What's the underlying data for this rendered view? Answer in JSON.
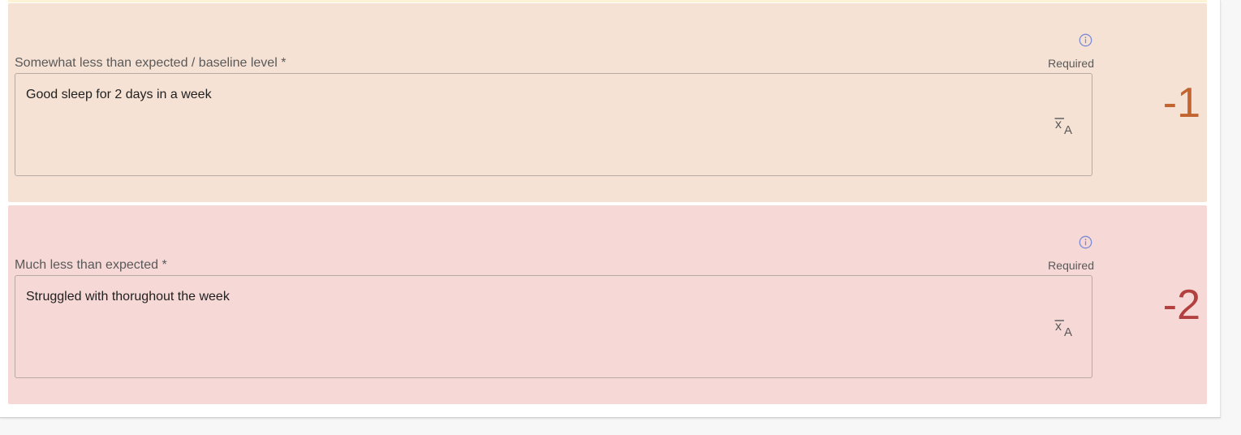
{
  "colors": {
    "panel_minus1_bg": "#f6e2d4",
    "panel_minus2_bg": "#f6d8d6",
    "score_minus1": "#c2642f",
    "score_minus2": "#b2403e",
    "info_icon": "#7a8bd6",
    "text_muted": "#595959"
  },
  "levels": [
    {
      "label": "Somewhat less than expected / baseline level *",
      "required": "Required",
      "value": "Good sleep for 2 days in a week",
      "score": "-1",
      "info_icon": "info-circle-icon",
      "translate_icon": "translate-icon"
    },
    {
      "label": "Much less than expected *",
      "required": "Required",
      "value": "Struggled with thorughout the week",
      "score": "-2",
      "info_icon": "info-circle-icon",
      "translate_icon": "translate-icon"
    }
  ]
}
